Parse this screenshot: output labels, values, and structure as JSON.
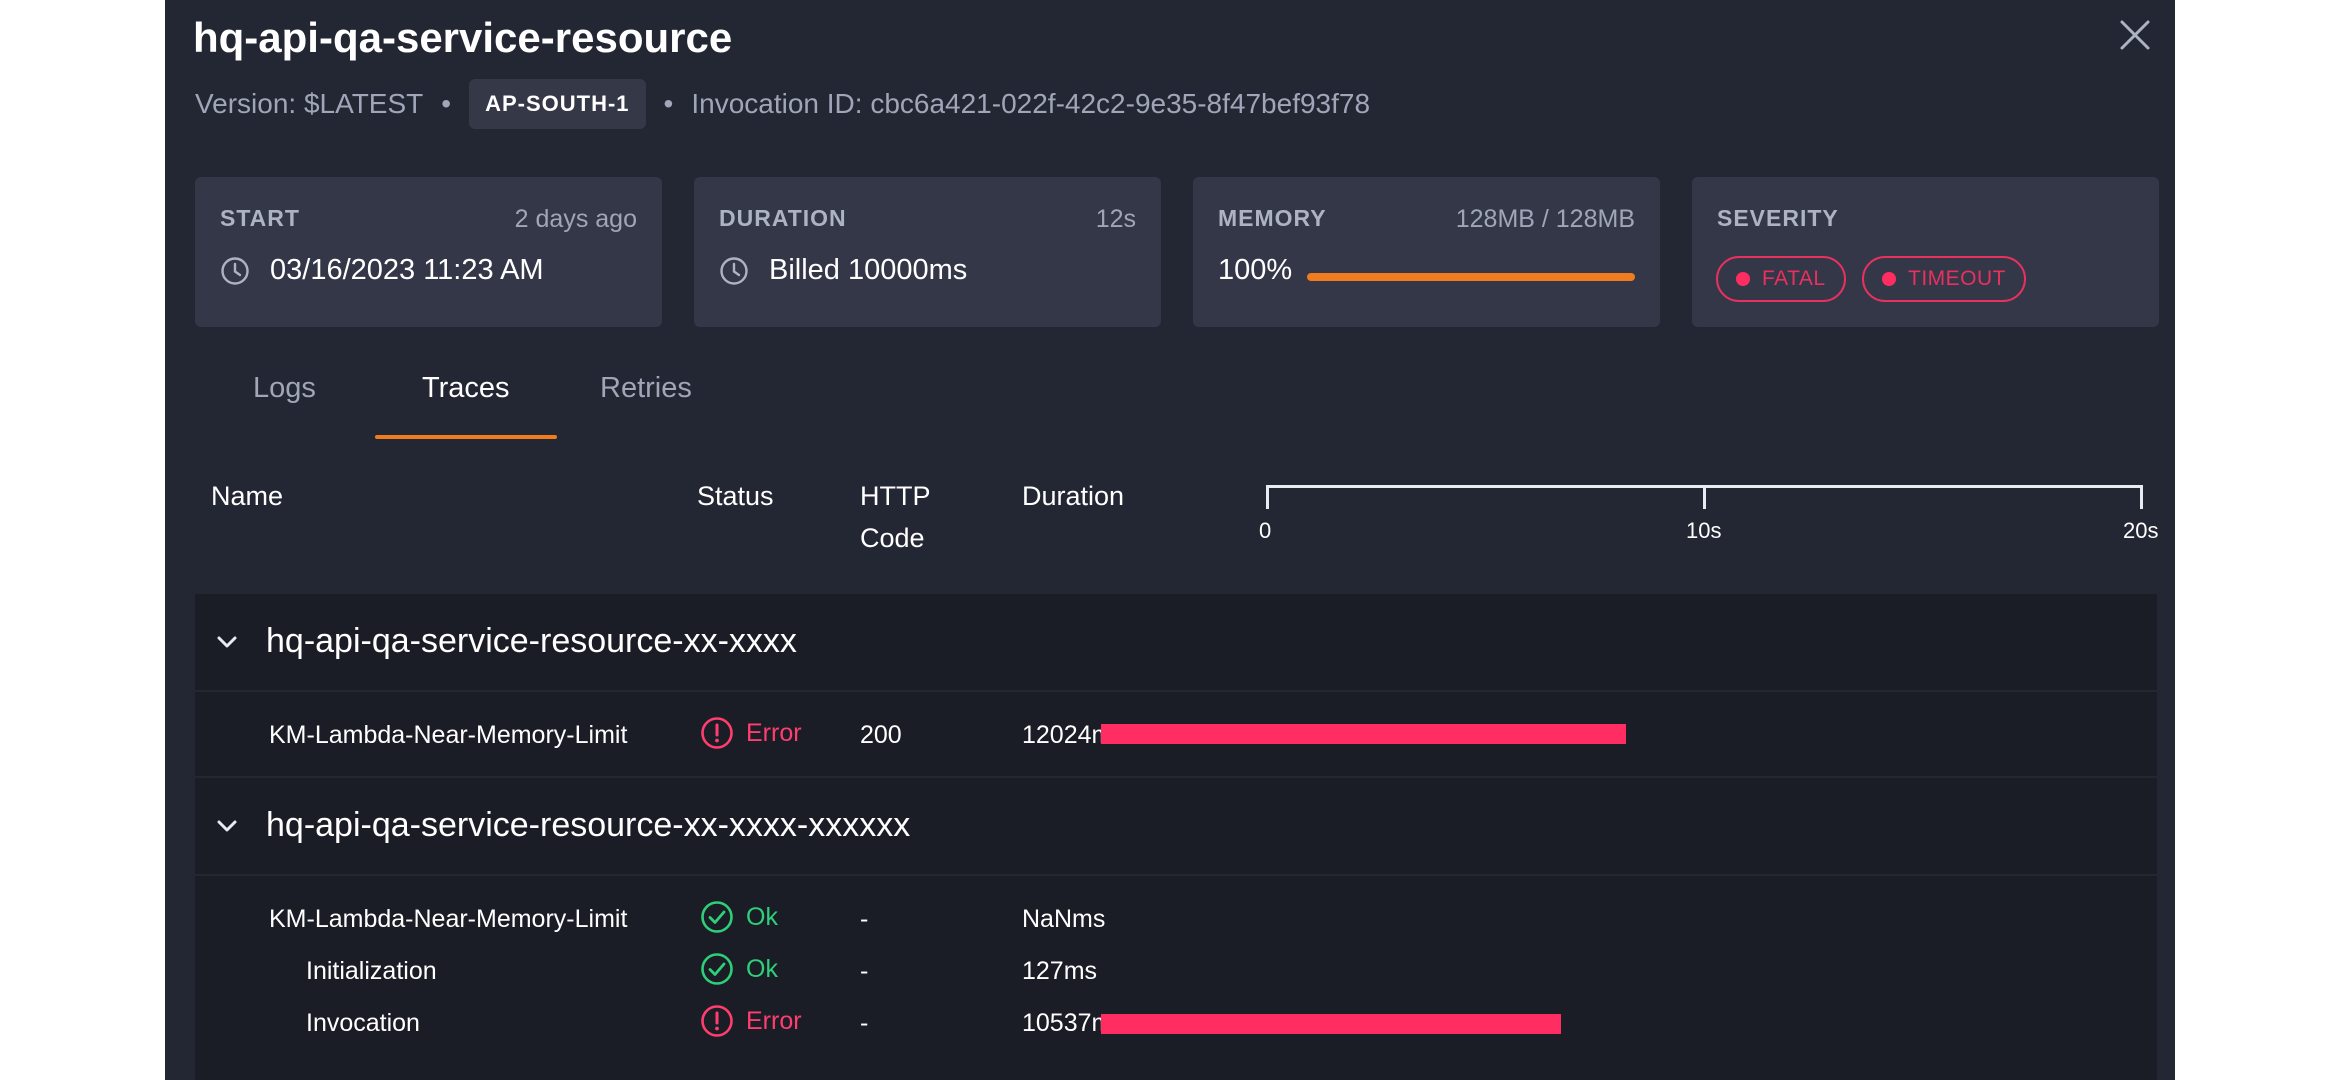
{
  "header": {
    "title": "hq-api-qa-service-resource",
    "version": "Version: $LATEST",
    "separator": "•",
    "region": "AP-SOUTH-1",
    "invocation": "Invocation ID: cbc6a421-022f-42c2-9e35-8f47bef93f78"
  },
  "cards": {
    "start": {
      "label": "START",
      "aside": "2 days ago",
      "value": "03/16/2023 11:23 AM"
    },
    "duration": {
      "label": "DURATION",
      "aside": "12s",
      "value": "Billed 10000ms"
    },
    "memory": {
      "label": "MEMORY",
      "aside": "128MB / 128MB",
      "value": "100%",
      "fill_fraction": 1.0
    },
    "severity": {
      "label": "SEVERITY",
      "badges": [
        "FATAL",
        "TIMEOUT"
      ]
    }
  },
  "tabs": [
    "Logs",
    "Traces",
    "Retries"
  ],
  "active_tab": "Traces",
  "table": {
    "headers": {
      "name": "Name",
      "status": "Status",
      "http_line1": "HTTP",
      "http_line2": "Code",
      "duration": "Duration"
    },
    "timeline": {
      "min_s": 0,
      "max_s": 20,
      "ticks": [
        "0",
        "10s",
        "20s"
      ]
    }
  },
  "groups": [
    {
      "title": "hq-api-qa-service-resource-xx-xxxx",
      "rows": [
        {
          "name": "KM-Lambda-Near-Memory-Limit",
          "status": "Error",
          "http": "200",
          "duration": "12024ms",
          "start_ms": 0,
          "duration_ms": 12024
        }
      ]
    },
    {
      "title": "hq-api-qa-service-resource-xx-xxxx-xxxxxx",
      "rows": [
        {
          "name": "KM-Lambda-Near-Memory-Limit",
          "status": "Ok",
          "http": "-",
          "duration": "NaNms"
        },
        {
          "name": "Initialization",
          "status": "Ok",
          "http": "-",
          "duration": "127ms"
        },
        {
          "name": "Invocation",
          "status": "Error",
          "http": "-",
          "duration": "10537ms",
          "start_ms": 0,
          "duration_ms": 10537
        }
      ]
    }
  ],
  "colors": {
    "accent": "#f07c1f",
    "error": "#ff2d61",
    "ok": "#2ecf78",
    "panel": "#232633"
  }
}
